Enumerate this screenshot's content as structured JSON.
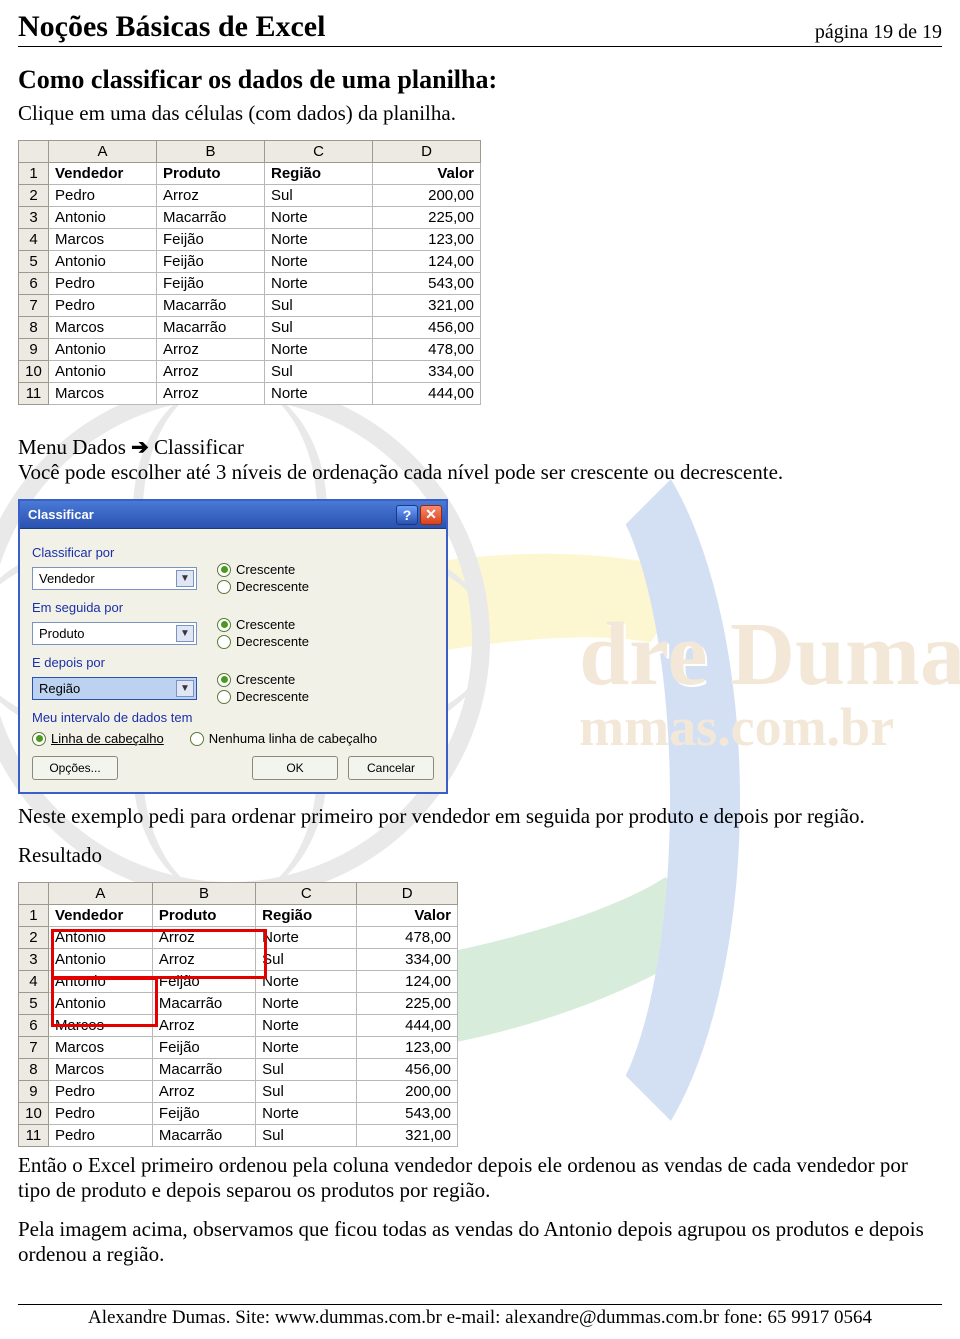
{
  "header": {
    "title": "Noções Básicas de Excel",
    "page_label": "página 19 de 19"
  },
  "section_title": "Como classificar os dados de uma planilha:",
  "intro": "Clique em uma das células (com dados) da planilha.",
  "watermark": {
    "line1": "dre Dumas",
    "line2": "mmas.com.br"
  },
  "sheet1": {
    "columns": [
      "A",
      "B",
      "C",
      "D"
    ],
    "headers": [
      "Vendedor",
      "Produto",
      "Região",
      "Valor"
    ],
    "rows": [
      [
        "Pedro",
        "Arroz",
        "Sul",
        "200,00"
      ],
      [
        "Antonio",
        "Macarrão",
        "Norte",
        "225,00"
      ],
      [
        "Marcos",
        "Feijão",
        "Norte",
        "123,00"
      ],
      [
        "Antonio",
        "Feijão",
        "Norte",
        "124,00"
      ],
      [
        "Pedro",
        "Feijão",
        "Norte",
        "543,00"
      ],
      [
        "Pedro",
        "Macarrão",
        "Sul",
        "321,00"
      ],
      [
        "Marcos",
        "Macarrão",
        "Sul",
        "456,00"
      ],
      [
        "Antonio",
        "Arroz",
        "Norte",
        "478,00"
      ],
      [
        "Antonio",
        "Arroz",
        "Sul",
        "334,00"
      ],
      [
        "Marcos",
        "Arroz",
        "Norte",
        "444,00"
      ]
    ]
  },
  "menu_line_prefix": "Menu Dados ",
  "menu_line_arrow": "→",
  "menu_line_suffix": " Classificar",
  "menu_desc": "Você pode escolher até 3 níveis de ordenação cada nível pode ser crescente ou decrescente.",
  "dialog": {
    "title": "Classificar",
    "group1_label": "Classificar por",
    "group2_label": "Em seguida por",
    "group3_label": "E depois por",
    "combo1": "Vendedor",
    "combo2": "Produto",
    "combo3": "Região",
    "opt_asc": "Crescente",
    "opt_desc": "Decrescente",
    "interval_label": "Meu intervalo de dados tem",
    "interval_opt1": "Linha de cabeçalho",
    "interval_opt2": "Nenhuma linha de cabeçalho",
    "btn_options": "Opções...",
    "btn_ok": "OK",
    "btn_cancel": "Cancelar"
  },
  "after_dialog": "Neste exemplo pedi para ordenar primeiro por vendedor em seguida por produto e depois por região.",
  "result_label": "Resultado",
  "sheet2": {
    "columns": [
      "A",
      "B",
      "C",
      "D"
    ],
    "headers": [
      "Vendedor",
      "Produto",
      "Região",
      "Valor"
    ],
    "rows": [
      [
        "Antonio",
        "Arroz",
        "Norte",
        "478,00"
      ],
      [
        "Antonio",
        "Arroz",
        "Sul",
        "334,00"
      ],
      [
        "Antonio",
        "Feijão",
        "Norte",
        "124,00"
      ],
      [
        "Antonio",
        "Macarrão",
        "Norte",
        "225,00"
      ],
      [
        "Marcos",
        "Arroz",
        "Norte",
        "444,00"
      ],
      [
        "Marcos",
        "Feijão",
        "Norte",
        "123,00"
      ],
      [
        "Marcos",
        "Macarrão",
        "Sul",
        "456,00"
      ],
      [
        "Pedro",
        "Arroz",
        "Sul",
        "200,00"
      ],
      [
        "Pedro",
        "Feijão",
        "Norte",
        "543,00"
      ],
      [
        "Pedro",
        "Macarrão",
        "Sul",
        "321,00"
      ]
    ]
  },
  "conclusion1": "Então o Excel primeiro ordenou pela coluna vendedor depois ele ordenou as vendas de cada vendedor por tipo de produto e depois separou os produtos por região.",
  "conclusion2": "Pela imagem acima, observamos que ficou todas as vendas do Antonio depois agrupou os produtos e depois ordenou a região.",
  "footer": "Alexandre Dumas. Site: www.dummas.com.br  e-mail: alexandre@dummas.com.br fone: 65 9917 0564"
}
